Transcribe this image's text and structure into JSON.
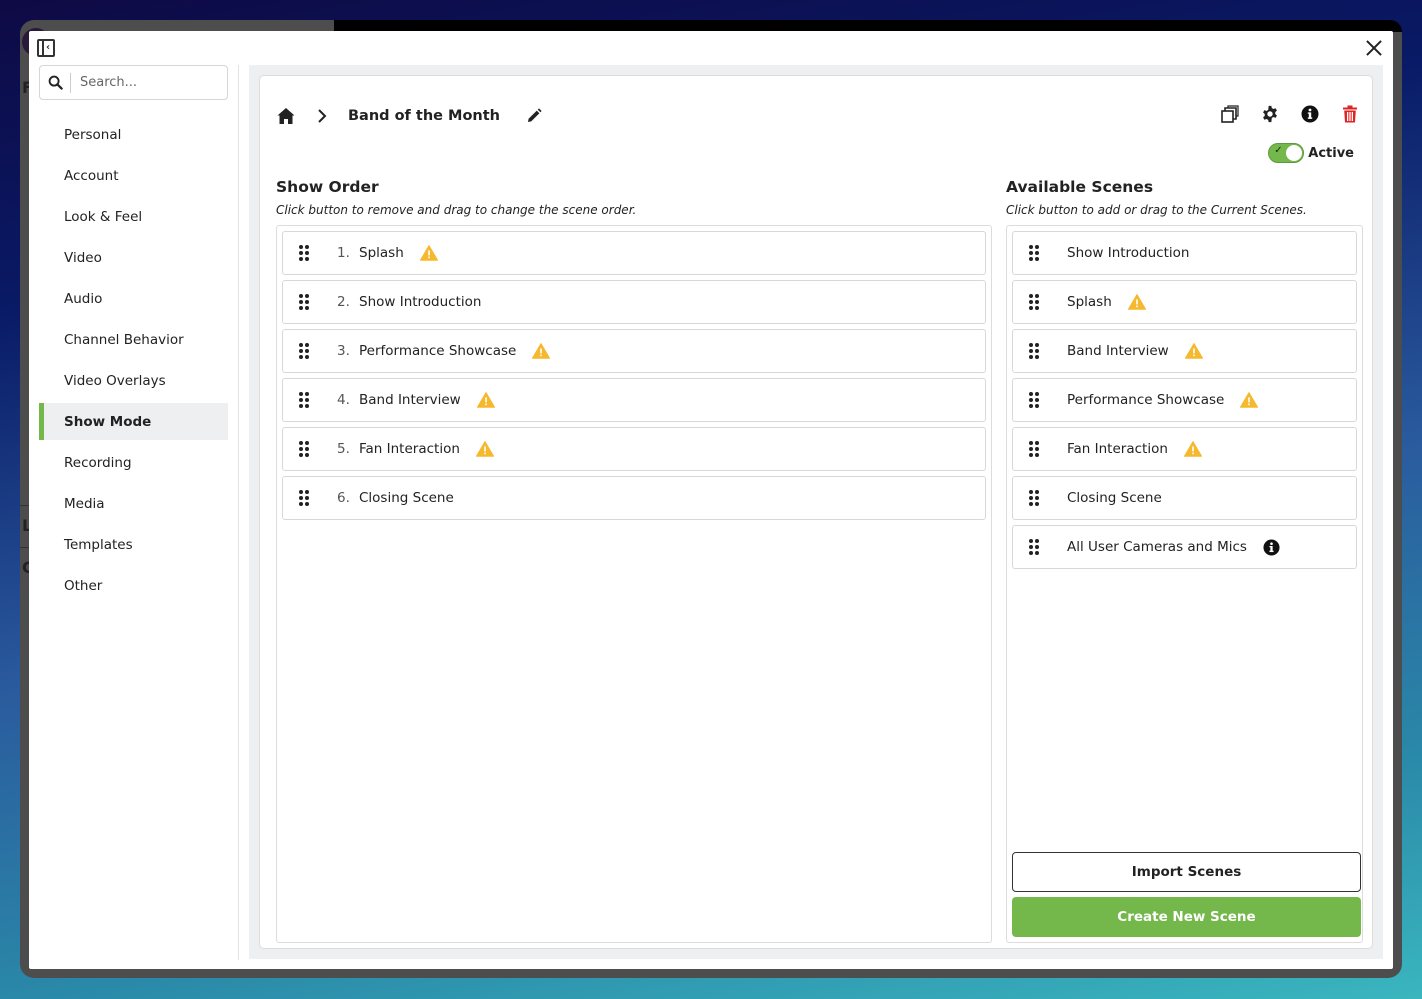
{
  "colors": {
    "accent": "#74b84c",
    "warning": "#f5b82e",
    "danger": "#e02424",
    "text": "#222222"
  },
  "modal": {
    "sidebar_toggle_icon": "panel-collapse-icon",
    "close_icon": "close-icon"
  },
  "sidebar": {
    "search": {
      "placeholder": "Search...",
      "value": ""
    },
    "items": [
      {
        "label": "Personal",
        "active": false
      },
      {
        "label": "Account",
        "active": false
      },
      {
        "label": "Look & Feel",
        "active": false
      },
      {
        "label": "Video",
        "active": false
      },
      {
        "label": "Audio",
        "active": false
      },
      {
        "label": "Channel Behavior",
        "active": false
      },
      {
        "label": "Video Overlays",
        "active": false
      },
      {
        "label": "Show Mode",
        "active": true
      },
      {
        "label": "Recording",
        "active": false
      },
      {
        "label": "Media",
        "active": false
      },
      {
        "label": "Templates",
        "active": false
      },
      {
        "label": "Other",
        "active": false
      }
    ]
  },
  "header": {
    "breadcrumb": {
      "home_icon": "home-icon",
      "separator_icon": "chevron-right-icon",
      "title": "Band of the Month",
      "edit_icon": "pencil-icon"
    },
    "toolbar": [
      {
        "name": "duplicate",
        "icon": "copy-icon"
      },
      {
        "name": "settings",
        "icon": "gear-icon"
      },
      {
        "name": "info",
        "icon": "info-icon"
      },
      {
        "name": "delete",
        "icon": "trash-icon"
      }
    ],
    "active_toggle": {
      "label": "Active",
      "on": true
    }
  },
  "show_order": {
    "title": "Show Order",
    "subtitle": "Click button to remove and drag to change the scene order.",
    "items": [
      {
        "num": "1.",
        "name": "Splash",
        "badge": "warning"
      },
      {
        "num": "2.",
        "name": "Show Introduction",
        "badge": ""
      },
      {
        "num": "3.",
        "name": "Performance Showcase",
        "badge": "warning"
      },
      {
        "num": "4.",
        "name": "Band Interview",
        "badge": "warning"
      },
      {
        "num": "5.",
        "name": "Fan Interaction",
        "badge": "warning"
      },
      {
        "num": "6.",
        "name": "Closing Scene",
        "badge": ""
      }
    ]
  },
  "available_scenes": {
    "title": "Available Scenes",
    "subtitle": "Click button to add or drag to the Current Scenes.",
    "items": [
      {
        "name": "Show Introduction",
        "badge": ""
      },
      {
        "name": "Splash",
        "badge": "warning"
      },
      {
        "name": "Band Interview",
        "badge": "warning"
      },
      {
        "name": "Performance Showcase",
        "badge": "warning"
      },
      {
        "name": "Fan Interaction",
        "badge": "warning"
      },
      {
        "name": "Closing Scene",
        "badge": ""
      },
      {
        "name": "All User Cameras and Mics",
        "badge": "info"
      }
    ],
    "import_label": "Import Scenes",
    "create_label": "Create New Scene"
  }
}
